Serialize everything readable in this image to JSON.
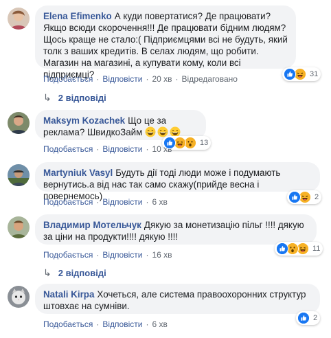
{
  "comments": [
    {
      "author": "Elena Efimenko",
      "text": "А куди повертатися? Де працювати? Якщо всюди скорочення!!! Де працювати бідним людям? Щось краще не стало:( Підприємцями всі не будуть, який толк з ваших кредитів. В селах людям, що робити. Магазин на магазині, а купувати кому, коли всі підприємці?",
      "reactions": [
        "like",
        "haha"
      ],
      "reaction_count": "31",
      "like_label": "Подобається",
      "reply_label": "Відповісти",
      "time": "20 хв",
      "edited": "Відредаговано",
      "replies_label": "2 відповіді"
    },
    {
      "author": "Maksym Kozachek",
      "text": "Що це за реклама? ШвидкоЗайм",
      "emojis": [
        "laughing-emoji",
        "laughing-emoji",
        "laughing-emoji"
      ],
      "reactions": [
        "like",
        "haha",
        "wow"
      ],
      "reaction_count": "13",
      "like_label": "Подобається",
      "reply_label": "Відповісти",
      "time": "10 хв"
    },
    {
      "author": "Martyniuk Vasyl",
      "text": "Будуть дії тоді люди може і подумають вернутись.а від нас так само скажу(прийде весна і повернемось)",
      "reactions": [
        "like",
        "haha"
      ],
      "reaction_count": "2",
      "like_label": "Подобається",
      "reply_label": "Відповісти",
      "time": "6 хв"
    },
    {
      "author": "Владимир Мотельчук",
      "text": "Дякую за монетизацію пільг !!!! дякую за ціни на продукти!!!! дякую !!!!",
      "reactions": [
        "like",
        "wow",
        "haha"
      ],
      "reaction_count": "11",
      "like_label": "Подобається",
      "reply_label": "Відповісти",
      "time": "16 хв",
      "replies_label": "2 відповіді"
    },
    {
      "author": "Natali Kirpa",
      "text": "Хочеться, але система правоохоронних структур штовхає на сумніви.",
      "reactions": [
        "like"
      ],
      "reaction_count": "2",
      "like_label": "Подобається",
      "reply_label": "Відповісти",
      "time": "6 хв"
    }
  ],
  "colors": {
    "link": "#385898",
    "bubble": "#f2f3f5",
    "meta": "#606770",
    "like": "#1877f2",
    "haha": "#f7b125"
  }
}
